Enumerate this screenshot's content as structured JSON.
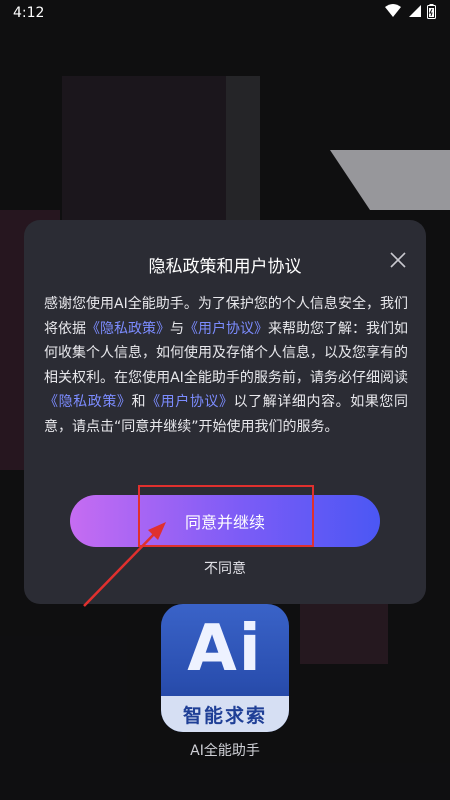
{
  "status_bar": {
    "time": "4:12",
    "icons": [
      "wifi-icon",
      "signal-icon",
      "battery-icon"
    ]
  },
  "dialog": {
    "title": "隐私政策和用户协议",
    "body": {
      "p1": "感谢您使用AI全能助手。为了保护您的个人信息安全，我们将依据",
      "link_privacy": "《隐私政策》",
      "and1": "与",
      "link_agreement": "《用户协议》",
      "p2": "来帮助您了解：我们如何收集个人信息，如何使用及存储个人信息，以及您享有的相关权利。在您使用AI全能助手的服务前，请务必仔细阅读",
      "link_privacy2": "《隐私政策》",
      "and2": "和",
      "link_agreement2": "《用户协议》",
      "p3": "以了解详细内容。如果您同意，请点击“同意并继续”开始使用我们的服务。"
    },
    "agree_label": "同意并继续",
    "disagree_label": "不同意"
  },
  "app": {
    "icon_text": "Ai",
    "icon_band_text": "智能求索",
    "label": "AI全能助手"
  },
  "colors": {
    "link": "#7c8cff",
    "button_gradient_start": "#c66cf2",
    "button_gradient_end": "#4b57f4",
    "highlight": "#e0302e"
  }
}
